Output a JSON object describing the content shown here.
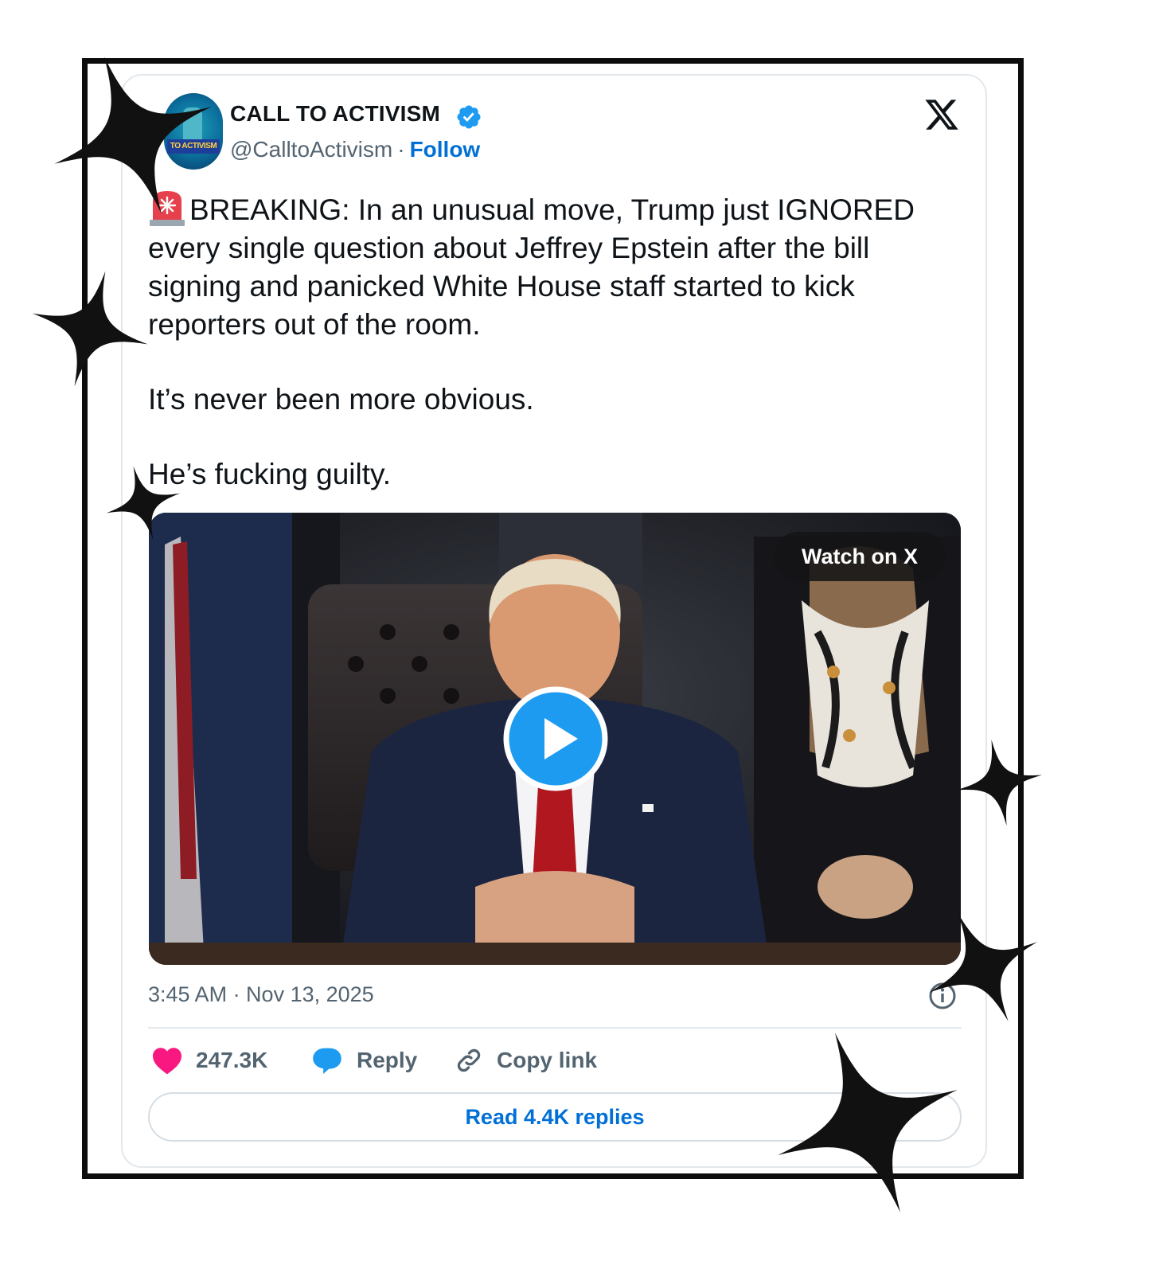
{
  "author": {
    "name": "CALL TO ACTIVISM",
    "handle": "@CalltoActivism",
    "separator": "·",
    "follow_label": "Follow",
    "avatar_text": "TO ACTIVISM",
    "verified_icon": "verified-badge-icon"
  },
  "platform_logo": "x-logo-icon",
  "tweet": {
    "paragraph_1": "BREAKING: In an unusual move, Trump just IGNORED every single question about Jeffrey Epstein after the bill signing and panicked White House staff started to kick reporters out of the room.",
    "paragraph_2": "It’s never been more obvious.",
    "paragraph_3": "He’s fucking guilty.",
    "emoji": "siren-icon"
  },
  "media": {
    "type": "video",
    "watch_label": "Watch on X",
    "play_icon": "play-icon"
  },
  "timestamp": "3:45 AM · Nov 13, 2025",
  "actions": {
    "likes": "247.3K",
    "reply_label": "Reply",
    "copy_link_label": "Copy link"
  },
  "read_replies_label": "Read 4.4K replies",
  "colors": {
    "accent_blue": "#006fd6",
    "heart_pink": "#f91880",
    "reply_blue": "#1d9bf0",
    "text_primary": "#0f1419",
    "text_secondary": "#536471",
    "frame_black": "#0d0d0d"
  }
}
